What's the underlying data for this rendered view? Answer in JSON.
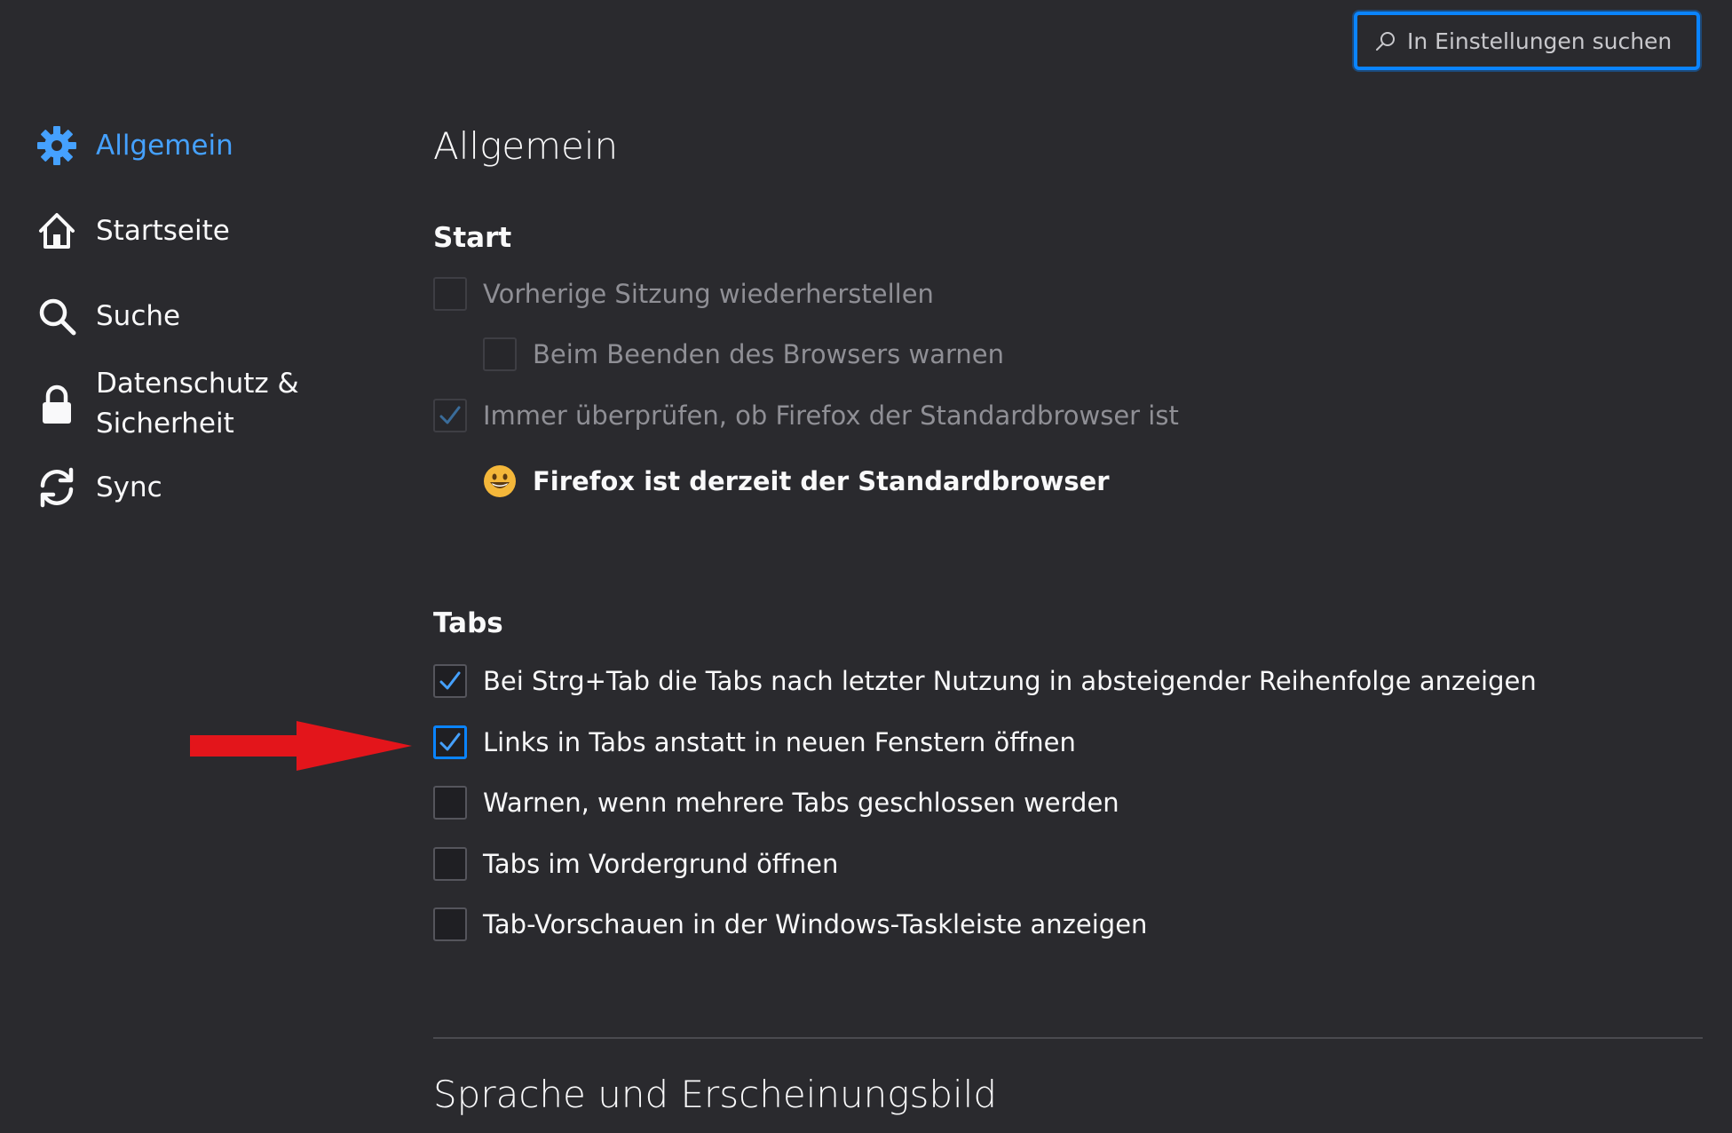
{
  "search": {
    "placeholder": "In Einstellungen suchen"
  },
  "sidebar": {
    "items": [
      {
        "label": "Allgemein",
        "icon": "gear-icon",
        "selected": true
      },
      {
        "label": "Startseite",
        "icon": "home-icon"
      },
      {
        "label": "Suche",
        "icon": "search-icon"
      },
      {
        "label": "Datenschutz &",
        "label_line2": "Sicherheit",
        "icon": "lock-icon"
      },
      {
        "label": "Sync",
        "icon": "sync-icon"
      }
    ]
  },
  "main": {
    "title": "Allgemein",
    "start": {
      "heading": "Start",
      "restore_session": {
        "label": "Vorherige Sitzung wiederherstellen",
        "checked": false,
        "disabled": true
      },
      "warn_on_quit": {
        "label": "Beim Beenden des Browsers warnen",
        "checked": false,
        "disabled": true
      },
      "check_default": {
        "label": "Immer überprüfen, ob Firefox der Standardbrowser ist",
        "checked": true,
        "disabled": true
      },
      "default_status": {
        "label": "Firefox ist derzeit der Standardbrowser",
        "icon": "smiley-icon"
      }
    },
    "tabs": {
      "heading": "Tabs",
      "options": [
        {
          "label": "Bei Strg+Tab die Tabs nach letzter Nutzung in absteigender Reihenfolge anzeigen",
          "checked": true
        },
        {
          "label": "Links in Tabs anstatt in neuen Fenstern öffnen",
          "checked": true,
          "focused": true
        },
        {
          "label": "Warnen, wenn mehrere Tabs geschlossen werden",
          "checked": false
        },
        {
          "label": "Tabs im Vordergrund öffnen",
          "checked": false
        },
        {
          "label": "Tab-Vorschauen in der Windows-Taskleiste anzeigen",
          "checked": false
        }
      ]
    },
    "next_section_title": "Sprache und Erscheinungsbild"
  },
  "colors": {
    "accent": "#0a84ff",
    "selected_nav": "#45a1ff",
    "arrow": "#e3151b",
    "background": "#2a2a2e"
  }
}
